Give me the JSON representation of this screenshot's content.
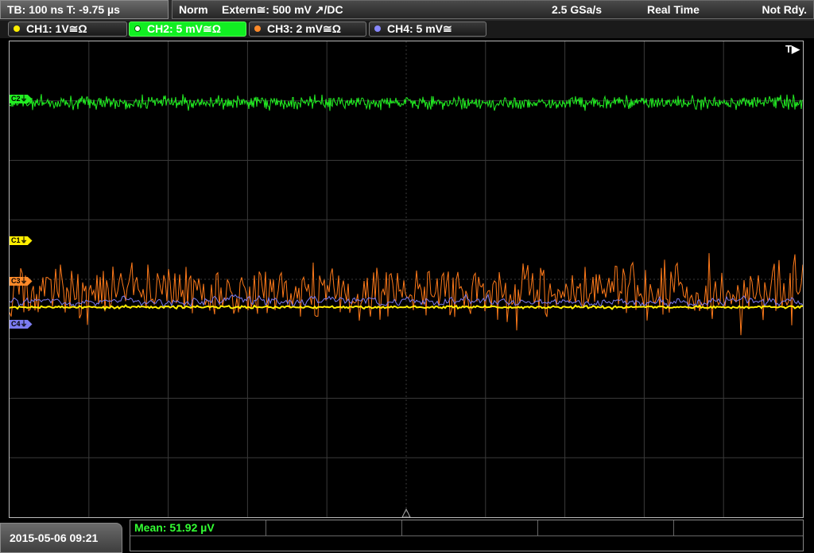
{
  "header": {
    "timebase": "TB: 100 ns   T: -9.75 µs",
    "mode": "Norm",
    "trigger": "Extern≅: 500 mV ↗/DC",
    "sample_rate": "2.5 GSa/s",
    "acquisition": "Real Time",
    "status": "Not Rdy."
  },
  "channels": [
    {
      "label": "CH1: 1V≅Ω",
      "color": "#ffee00",
      "active": false
    },
    {
      "label": "CH2: 5 mV≅Ω",
      "color": "#22ee22",
      "active": true
    },
    {
      "label": "CH3: 2 mV≅Ω",
      "color": "#ff8a2a",
      "active": false
    },
    {
      "label": "CH4: 5 mV≅",
      "color": "#8888ff",
      "active": false
    }
  ],
  "markers": {
    "c1": "C1⏚",
    "c2": "C2⏚",
    "c3": "C3⏚",
    "c4": "C4⏚",
    "trigger": "T▶"
  },
  "footer": {
    "datetime": "2015-05-06 09:21",
    "measurement": "Mean: 51.92 µV"
  },
  "colors": {
    "ch1": "#ffee00",
    "ch2": "#22ee22",
    "ch3": "#ff7a1a",
    "ch4": "#7c7cf0",
    "grid": "#3a3a3a"
  }
}
